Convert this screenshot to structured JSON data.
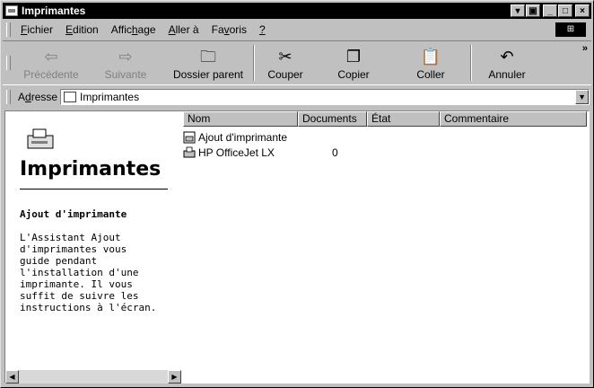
{
  "window": {
    "title": "Imprimantes"
  },
  "title_buttons": [
    "▾",
    "▣",
    "_",
    "□",
    "×"
  ],
  "menubar": {
    "items": [
      {
        "pre": "",
        "u": "F",
        "post": "ichier"
      },
      {
        "pre": "",
        "u": "E",
        "post": "dition"
      },
      {
        "pre": "Affic",
        "u": "h",
        "post": "age"
      },
      {
        "pre": "",
        "u": "A",
        "post": "ller à"
      },
      {
        "pre": "Fa",
        "u": "v",
        "post": "oris"
      },
      {
        "pre": "",
        "u": "?",
        "post": ""
      }
    ]
  },
  "toolbar": {
    "back": "Précédente",
    "forward": "Suivante",
    "parent": "Dossier parent",
    "cut": "Couper",
    "copy": "Copier",
    "paste": "Coller",
    "undo": "Annuler",
    "chevron": "»"
  },
  "address": {
    "label_pre": "A",
    "label_u": "d",
    "label_post": "resse",
    "value": "Imprimantes"
  },
  "left_pane": {
    "title": "Imprimantes",
    "subtitle": "Ajout d'imprimante",
    "description": "L'Assistant Ajout\nd'imprimantes vous\nguide pendant\nl'installation d'une\nimprimante. Il vous\nsuffit de suivre les\ninstructions à l'écran."
  },
  "list": {
    "columns": [
      "Nom",
      "Documents",
      "État",
      "Commentaire"
    ],
    "rows": [
      {
        "name": "Ajout d'imprimante",
        "documents": "",
        "icon": "add-printer-icon"
      },
      {
        "name": "HP OfficeJet LX",
        "documents": "0",
        "icon": "printer-icon"
      }
    ]
  }
}
